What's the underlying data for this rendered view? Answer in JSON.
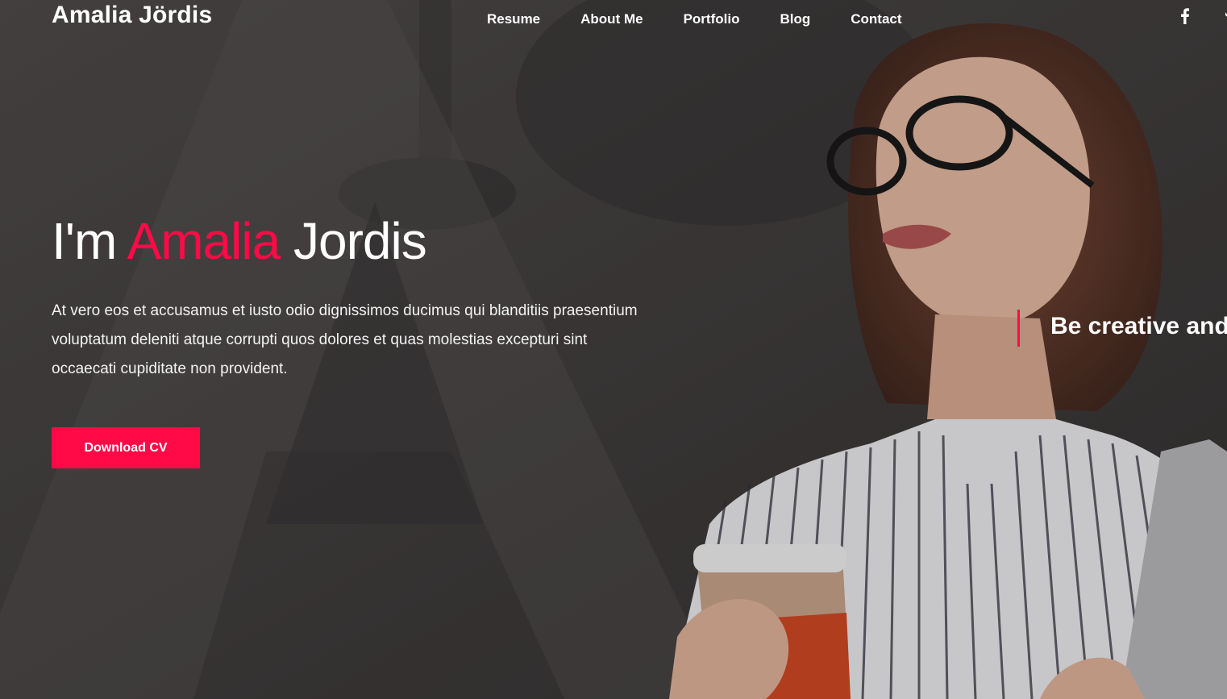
{
  "header": {
    "brand": "Amalia Jördis",
    "nav": [
      "Resume",
      "About Me",
      "Portfolio",
      "Blog",
      "Contact"
    ],
    "social_icons": [
      "facebook-icon",
      "twitter-icon"
    ]
  },
  "hero": {
    "headline_prefix": "I'm ",
    "headline_accent": "Amalia",
    "headline_suffix": " Jordis",
    "lead": "At vero eos et accusamus et iusto odio dignissimos ducimus qui blanditiis praesentium voluptatum deleniti atque corrupti quos dolores et quas molestias excepturi sint occaecati cupiditate non provident.",
    "cta_label": "Download CV",
    "tagline": "Be creative and"
  },
  "colors": {
    "accent": "#ff0a47",
    "overlay": "#3a3636"
  }
}
